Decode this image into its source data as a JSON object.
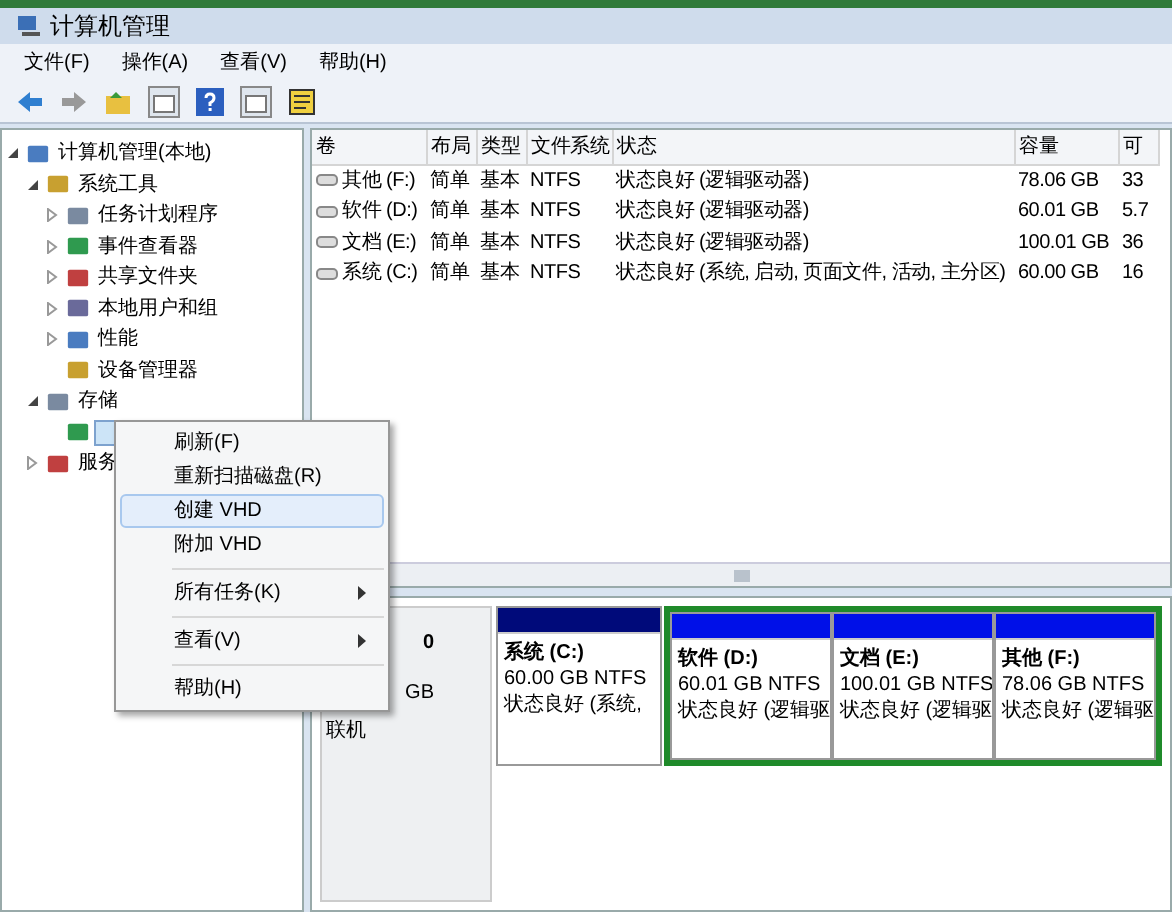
{
  "window": {
    "title": "计算机管理"
  },
  "menu_bar": [
    "文件(F)",
    "操作(A)",
    "查看(V)",
    "帮助(H)"
  ],
  "tree": [
    {
      "label": "计算机管理(本地)",
      "expanded": true,
      "selected": false,
      "children": [
        {
          "label": "系统工具",
          "expanded": true,
          "selected": false,
          "children": [
            {
              "label": "任务计划程序",
              "expanded": false,
              "selected": false
            },
            {
              "label": "事件查看器",
              "expanded": false,
              "selected": false
            },
            {
              "label": "共享文件夹",
              "expanded": false,
              "selected": false
            },
            {
              "label": "本地用户和组",
              "expanded": false,
              "selected": false
            },
            {
              "label": "性能",
              "expanded": false,
              "selected": false
            },
            {
              "label": "设备管理器",
              "selected": false
            }
          ]
        },
        {
          "label": "存储",
          "expanded": true,
          "selected": false,
          "children": [
            {
              "selected": true
            }
          ]
        },
        {
          "label": "服务",
          "expanded": false,
          "selected": false
        }
      ]
    }
  ],
  "table": {
    "columns": [
      "卷",
      "布局",
      "类型",
      "文件系统",
      "状态",
      "容量",
      "可"
    ],
    "rows": [
      [
        "其他 (F:)",
        "简单",
        "基本",
        "NTFS",
        "状态良好 (逻辑驱动器)",
        "78.06 GB",
        "33"
      ],
      [
        "软件 (D:)",
        "简单",
        "基本",
        "NTFS",
        "状态良好 (逻辑驱动器)",
        "60.01 GB",
        "5.7"
      ],
      [
        "文档 (E:)",
        "简单",
        "基本",
        "NTFS",
        "状态良好 (逻辑驱动器)",
        "100.01 GB",
        "36"
      ],
      [
        "系统 (C:)",
        "简单",
        "基本",
        "NTFS",
        "状态良好 (系统, 启动, 页面文件, 活动, 主分区)",
        "60.00 GB",
        "16"
      ]
    ]
  },
  "disk": {
    "label": "0",
    "size": "GB",
    "status": "联机",
    "partitions": [
      {
        "name": "系统 (C:)",
        "size": "60.00 GB NTFS",
        "status": "状态良好 (系统,",
        "kind": "primary"
      },
      {
        "name": "软件 (D:)",
        "size": "60.01 GB NTFS",
        "status": "状态良好 (逻辑驱",
        "kind": "logical"
      },
      {
        "name": "文档 (E:)",
        "size": "100.01 GB NTFS",
        "status": "状态良好 (逻辑驱",
        "kind": "logical"
      },
      {
        "name": "其他 (F:)",
        "size": "78.06 GB NTFS",
        "status": "状态良好 (逻辑驱",
        "kind": "logical"
      }
    ]
  },
  "context_menu": [
    {
      "label": "刷新(F)",
      "kind": "item",
      "selected": false
    },
    {
      "label": "重新扫描磁盘(R)",
      "kind": "item",
      "selected": false
    },
    {
      "label": "创建 VHD",
      "kind": "item",
      "selected": true
    },
    {
      "label": "附加 VHD",
      "kind": "item",
      "selected": false
    },
    {
      "kind": "separator"
    },
    {
      "label": "所有任务(K)",
      "kind": "submenu",
      "selected": false
    },
    {
      "kind": "separator"
    },
    {
      "label": "查看(V)",
      "kind": "submenu",
      "selected": false
    },
    {
      "kind": "separator"
    },
    {
      "label": "帮助(H)",
      "kind": "item",
      "selected": false
    }
  ]
}
